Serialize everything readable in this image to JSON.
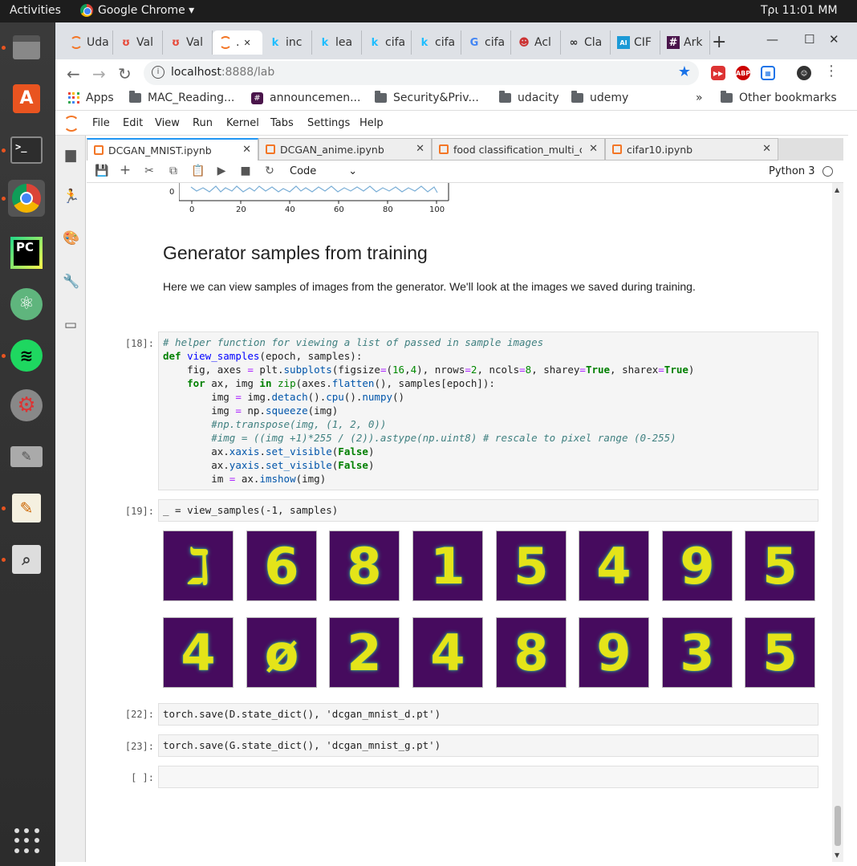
{
  "topbar": {
    "activities": "Activities",
    "app": "Google Chrome ▾",
    "clock": "Τρι 11:01 ΜΜ"
  },
  "browser": {
    "tabs": [
      {
        "label": "Uda",
        "icon": "jupyter-icon"
      },
      {
        "label": "Val",
        "icon": "udacity-icon"
      },
      {
        "label": "Val",
        "icon": "udacity-icon"
      },
      {
        "label": ".",
        "icon": "jupyter-icon"
      },
      {
        "label": "inc",
        "icon": "kaggle-icon"
      },
      {
        "label": "lea",
        "icon": "kaggle-icon"
      },
      {
        "label": "cifa",
        "icon": "kaggle-icon"
      },
      {
        "label": "cifa",
        "icon": "kaggle-icon"
      },
      {
        "label": "cifa",
        "icon": "google-icon"
      },
      {
        "label": "Acl",
        "icon": "avatar-icon"
      },
      {
        "label": "Cla",
        "icon": "glasses-icon"
      },
      {
        "label": "CIF",
        "icon": "ai-icon"
      },
      {
        "label": "Ark",
        "icon": "slack-icon"
      }
    ],
    "url_host": "localhost",
    "url_rest": ":8888/lab",
    "bookmarks": [
      "Apps",
      "MAC_Reading...",
      "announcemen...",
      "Security&Priv...",
      "udacity",
      "udemy"
    ],
    "other_bookmarks": "Other bookmarks",
    "more": "»"
  },
  "jupyter": {
    "menu": [
      "File",
      "Edit",
      "View",
      "Run",
      "Kernel",
      "Tabs",
      "Settings",
      "Help"
    ],
    "doc_tabs": [
      "DCGAN_MNIST.ipynb",
      "DCGAN_anime.ipynb",
      "food classification_multi_crc",
      "cifar10.ipynb"
    ],
    "cell_type": "Code",
    "kernel": "Python 3"
  },
  "notebook": {
    "plot_ticks_x": [
      "0",
      "20",
      "40",
      "60",
      "80",
      "100"
    ],
    "plot_tick_y": "0",
    "heading": "Generator samples from training",
    "paragraph": "Here we can view samples of images from the generator. We'll look at the images we saved during training.",
    "prompts": [
      "[18]:",
      "[19]:",
      "[22]:",
      "[23]:",
      "[ ]:"
    ],
    "code_18": [
      "# helper function for viewing a list of passed in sample images",
      "def view_samples(epoch, samples):",
      "    fig, axes = plt.subplots(figsize=(16,4), nrows=2, ncols=8, sharey=True, sharex=True)",
      "    for ax, img in zip(axes.flatten(), samples[epoch]):",
      "        img = img.detach().cpu().numpy()",
      "        img = np.squeeze(img)",
      "        #np.transpose(img, (1, 2, 0))",
      "        #img = ((img +1)*255 / (2)).astype(np.uint8) # rescale to pixel range (0-255)",
      "        ax.xaxis.set_visible(False)",
      "        ax.yaxis.set_visible(False)",
      "        im = ax.imshow(img)"
    ],
    "code_19": "_ = view_samples(-1, samples)",
    "code_22": "torch.save(D.state_dict(), 'dcgan_mnist_d.pt')",
    "code_23": "torch.save(G.state_dict(), 'dcgan_mnist_g.pt')",
    "digits_row1": [
      "ℷ",
      "6",
      "8",
      "1",
      "5",
      "4",
      "9",
      "5"
    ],
    "digits_row2": [
      "4",
      "ø",
      "2",
      "4",
      "8",
      "9",
      "3",
      "5"
    ]
  }
}
